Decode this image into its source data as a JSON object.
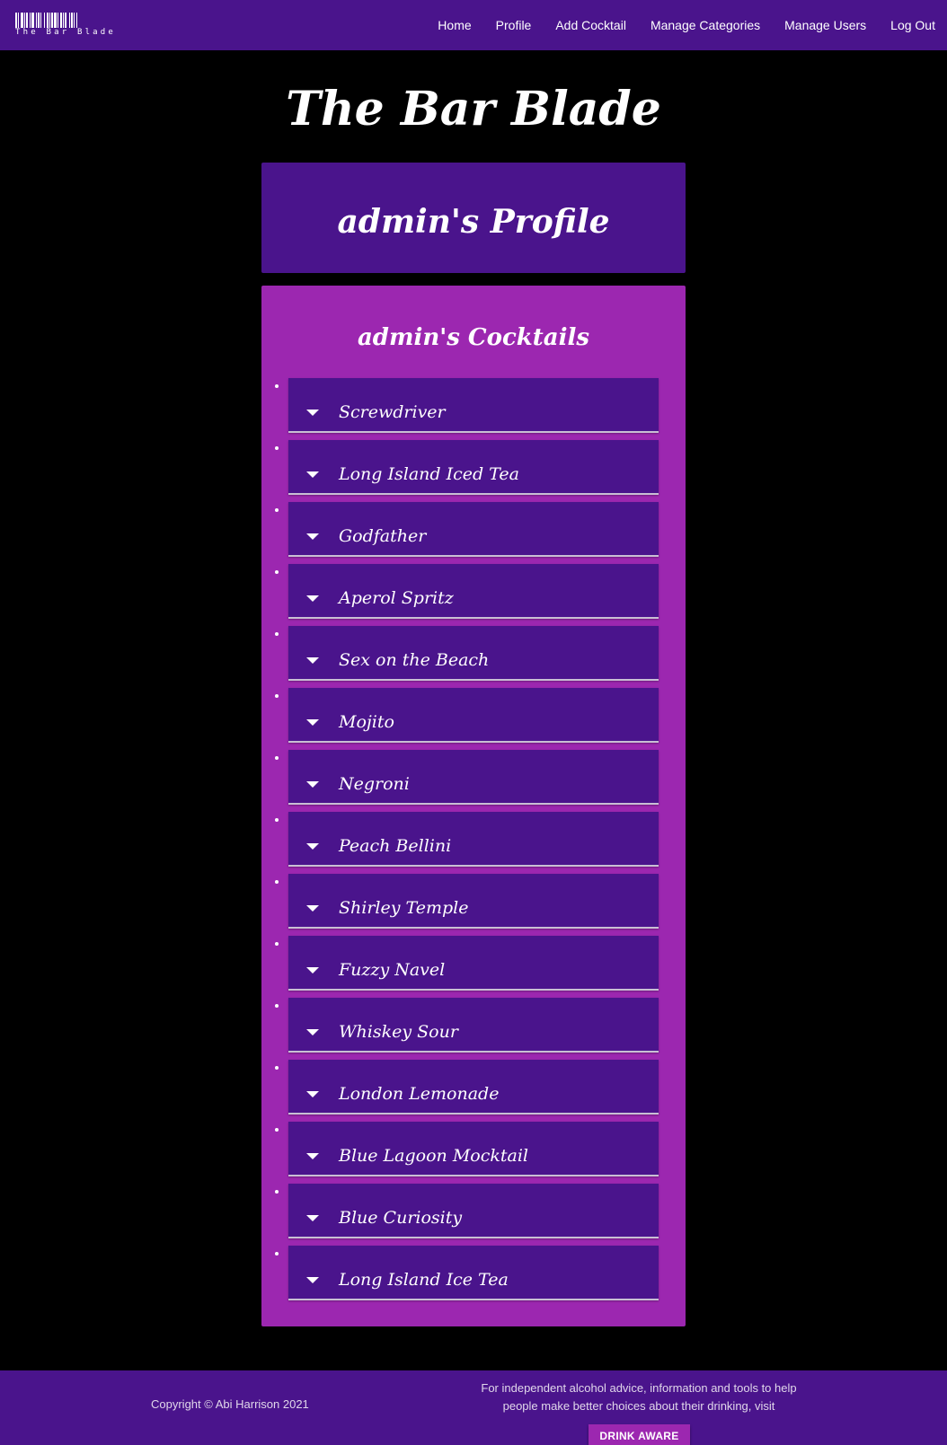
{
  "nav": {
    "brand_text": "The Bar Blade",
    "links": [
      "Home",
      "Profile",
      "Add Cocktail",
      "Manage Categories",
      "Manage Users",
      "Log Out"
    ]
  },
  "header": {
    "site_title": "The Bar Blade"
  },
  "profile": {
    "title": "admin's Profile"
  },
  "cocktails": {
    "title": "admin's Cocktails",
    "items": [
      "Screwdriver",
      "Long Island Iced Tea",
      "Godfather",
      "Aperol Spritz",
      "Sex on the Beach",
      "Mojito",
      "Negroni",
      "Peach Bellini",
      "Shirley Temple",
      "Fuzzy Navel",
      "Whiskey Sour",
      "London Lemonade",
      "Blue Lagoon Mocktail",
      "Blue Curiosity",
      "Long Island Ice Tea"
    ]
  },
  "footer": {
    "copyright": "Copyright © Abi Harrison 2021",
    "advice": "For independent alcohol advice, information and tools to help people make better choices about their drinking, visit",
    "drink_aware_label": "DRINK AWARE"
  },
  "colors": {
    "primary": "#4a148c",
    "accent": "#9c27b0",
    "background": "#000000"
  },
  "icons": {
    "brand": "barcode-logo-icon",
    "collapsible": "caret-down-icon"
  }
}
